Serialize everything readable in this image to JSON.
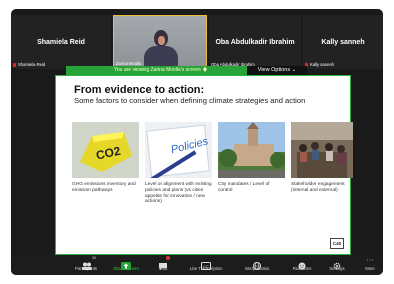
{
  "participants": {
    "tile1_name": "Shamiela Reid",
    "tile1_small": "Shamiela Reid",
    "tile2_small": "Zarina Moolla",
    "tile3_name": "Oba Abdulkadir Ibrahim",
    "tile3_small": "Oba Abdulkadir Ibrahim",
    "tile4_name": "Kally sanneh",
    "tile4_small": "Kally sanneh"
  },
  "share": {
    "banner": "You are viewing Zarina Moolla's screen",
    "view_options": "View Options ⌄"
  },
  "slide": {
    "title": "From evidence to action:",
    "subtitle": "Some factors to consider when defining climate strategies and action",
    "cards": [
      {
        "caption": "GHG emissions inventory and emission pathways",
        "img_text": "CO2"
      },
      {
        "caption": "Level or alignment with existing policies and plans (vs cities appetite for innovation / new actions)",
        "img_text": "Policies"
      },
      {
        "caption": "City mandates / Level of control",
        "img_text": ""
      },
      {
        "caption": "Stakeholder engagement (internal and external)",
        "img_text": ""
      }
    ],
    "corner_logo": "C40"
  },
  "toolbar": {
    "participants_label": "Participants",
    "participants_count": "30",
    "share_label": "Share Screen",
    "chat_label": "Chat",
    "transcription_label": "Live Transcription",
    "interpretation_label": "Interpretation",
    "reactions_label": "Reactions",
    "settings_label": "Settings",
    "more_label": "More"
  },
  "colors": {
    "accent_green": "#27a437",
    "active_speaker": "#e9c23a",
    "mic_muted": "#e02828"
  }
}
